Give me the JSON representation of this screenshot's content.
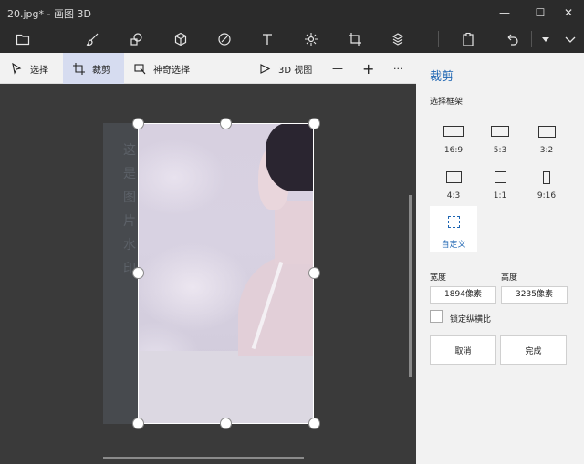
{
  "window": {
    "title": "20.jpg* - 画图 3D",
    "minimize_glyph": "—",
    "maximize_glyph": "☐",
    "close_glyph": "✕"
  },
  "toolbar": {
    "icons": [
      "folder-icon",
      "brush-icon",
      "2d-shapes-icon",
      "3d-shapes-icon",
      "stickers-icon",
      "text-icon",
      "effects-icon",
      "canvas-icon",
      "library-icon",
      "paste-icon",
      "undo-icon",
      "dropdown-icon",
      "expand-icon"
    ]
  },
  "subbar": {
    "select_label": "选择",
    "crop_label": "裁剪",
    "magic_select_label": "神奇选择",
    "view3d_label": "3D 视图",
    "zoom_out": "—",
    "zoom_in": "+",
    "more": "···"
  },
  "canvas": {
    "watermark_text": [
      "这",
      "是",
      "图",
      "片",
      "水",
      "印"
    ]
  },
  "panel": {
    "title": "裁剪",
    "frame_label": "选择框架",
    "ratios": [
      "16:9",
      "5:3",
      "3:2",
      "4:3",
      "1:1",
      "9:16"
    ],
    "custom_label": "自定义",
    "width_label": "宽度",
    "height_label": "高度",
    "width_value": "1894像素",
    "height_value": "3235像素",
    "lock_label": "锁定纵横比",
    "cancel_label": "取消",
    "done_label": "完成",
    "accent_color": "#1f66b3"
  }
}
